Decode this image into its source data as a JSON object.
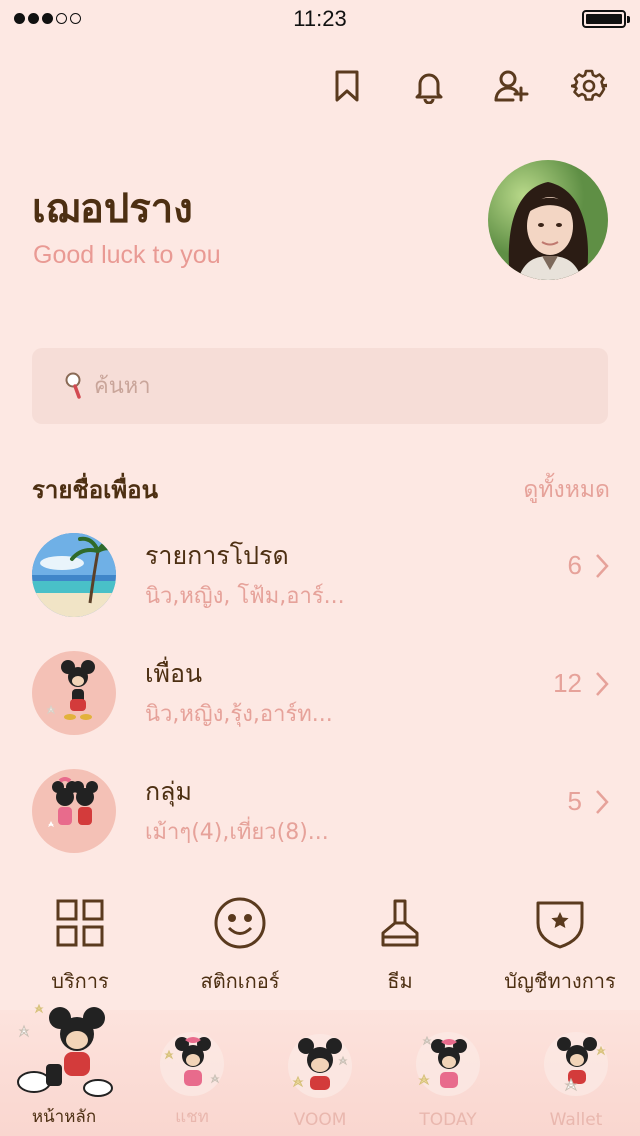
{
  "status_bar": {
    "time": "11:23",
    "signal_dots_filled": 3,
    "signal_dots_total": 5,
    "battery_level": 1.0
  },
  "top_actions": [
    {
      "icon": "bookmark-icon"
    },
    {
      "icon": "bell-icon"
    },
    {
      "icon": "add-friend-icon"
    },
    {
      "icon": "gear-icon"
    }
  ],
  "profile": {
    "name": "เฌอปราง",
    "status_message": "Good luck to you"
  },
  "search": {
    "placeholder": "ค้นหา"
  },
  "friends_section": {
    "title": "รายชื่อเพื่อน",
    "see_all": "ดูทั้งหมด",
    "rows": [
      {
        "title": "รายการโปรด",
        "subtitle": "นิว,หญิง, โฟ้ม,อาร์...",
        "count": "6"
      },
      {
        "title": "เพื่อน",
        "subtitle": "นิว,หญิง,รุ้ง,อาร์ท...",
        "count": "12"
      },
      {
        "title": "กลุ่ม",
        "subtitle": "เม้าๆ(4),เที่ยว(8)...",
        "count": "5"
      }
    ]
  },
  "shortcuts": [
    {
      "label": "บริการ",
      "icon": "grid-icon"
    },
    {
      "label": "สติกเกอร์",
      "icon": "smiley-icon"
    },
    {
      "label": "ธีม",
      "icon": "brush-icon"
    },
    {
      "label": "บัญชีทางการ",
      "icon": "shield-star-icon"
    }
  ],
  "tab_bar": {
    "active_index": 0,
    "tabs": [
      {
        "label": "หน้าหลัก"
      },
      {
        "label": "แชท"
      },
      {
        "label": "VOOM"
      },
      {
        "label": "TODAY"
      },
      {
        "label": "Wallet"
      }
    ]
  },
  "colors": {
    "background": "#fde8e3",
    "primary_text": "#4d2f12",
    "accent_pink": "#e6a29a",
    "search_bg": "#f6ddd7"
  }
}
